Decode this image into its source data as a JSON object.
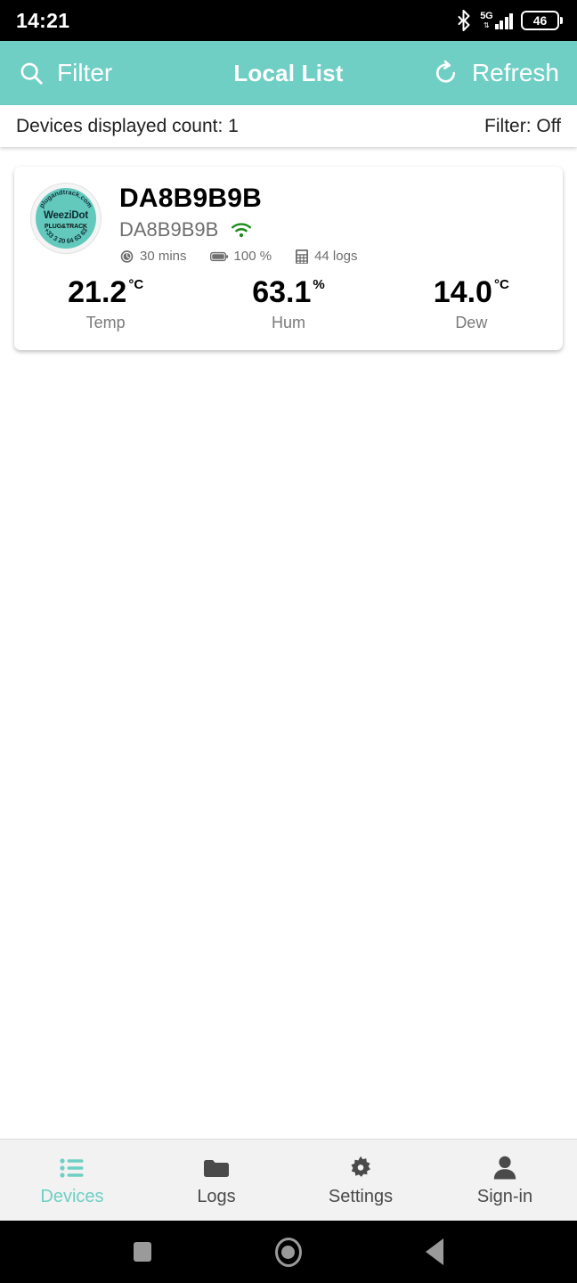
{
  "status_bar": {
    "time": "14:21",
    "bluetooth_icon": "bluetooth-icon",
    "network_label": "5G",
    "signal_icon": "signal-bars-icon",
    "battery_level": "46",
    "battery_icon": "battery-icon"
  },
  "app_bar": {
    "title": "Local List",
    "filter_label": "Filter",
    "filter_icon": "search-icon",
    "refresh_label": "Refresh",
    "refresh_icon": "refresh-icon",
    "accent_color": "#6fcfc4"
  },
  "info_strip": {
    "count_label": "Devices displayed count: 1",
    "filter_state": "Filter: Off"
  },
  "device_card": {
    "badge": {
      "top_arc": "plugandtrack.com",
      "name": "WeeziDot",
      "brand": "PLUG&TRACK",
      "bottom_arc": "+33 3 20 64 63 63"
    },
    "title": "DA8B9B9B",
    "device_id": "DA8B9B9B",
    "connection_icon": "wifi-icon",
    "connection_color": "#1a8a1a",
    "meta": [
      {
        "icon": "clock-icon",
        "text": "30 mins"
      },
      {
        "icon": "battery-icon",
        "text": "100 %"
      },
      {
        "icon": "memory-icon",
        "text": "44 logs"
      }
    ],
    "readings": [
      {
        "value": "21.2",
        "unit": "°C",
        "label": "Temp"
      },
      {
        "value": "63.1",
        "unit": "%",
        "label": "Hum"
      },
      {
        "value": "14.0",
        "unit": "°C",
        "label": "Dew"
      }
    ]
  },
  "bottom_nav": {
    "active_color": "#6fcfc4",
    "items": [
      {
        "label": "Devices",
        "icon": "list-icon",
        "active": true
      },
      {
        "label": "Logs",
        "icon": "folder-icon",
        "active": false
      },
      {
        "label": "Settings",
        "icon": "gear-icon",
        "active": false
      },
      {
        "label": "Sign-in",
        "icon": "person-icon",
        "active": false
      }
    ]
  },
  "android_nav": {
    "recents_icon": "square-recents-icon",
    "home_icon": "circle-home-icon",
    "back_icon": "triangle-back-icon"
  }
}
